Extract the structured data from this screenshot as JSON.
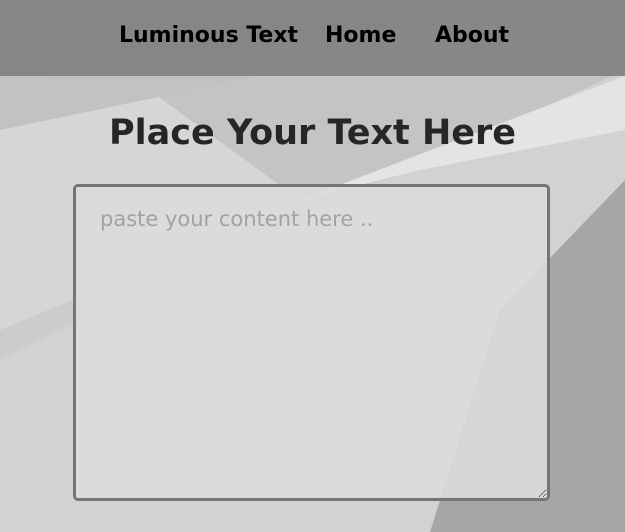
{
  "nav": {
    "brand": "Luminous Text",
    "links": [
      "Home",
      "About"
    ]
  },
  "main": {
    "title": "Place Your Text Here",
    "textarea_placeholder": "paste your content here ..",
    "textarea_value": ""
  },
  "colors": {
    "navbar": "#808080",
    "title": "#262626",
    "textarea_border": "#757575",
    "placeholder": "#9ea3ab"
  }
}
